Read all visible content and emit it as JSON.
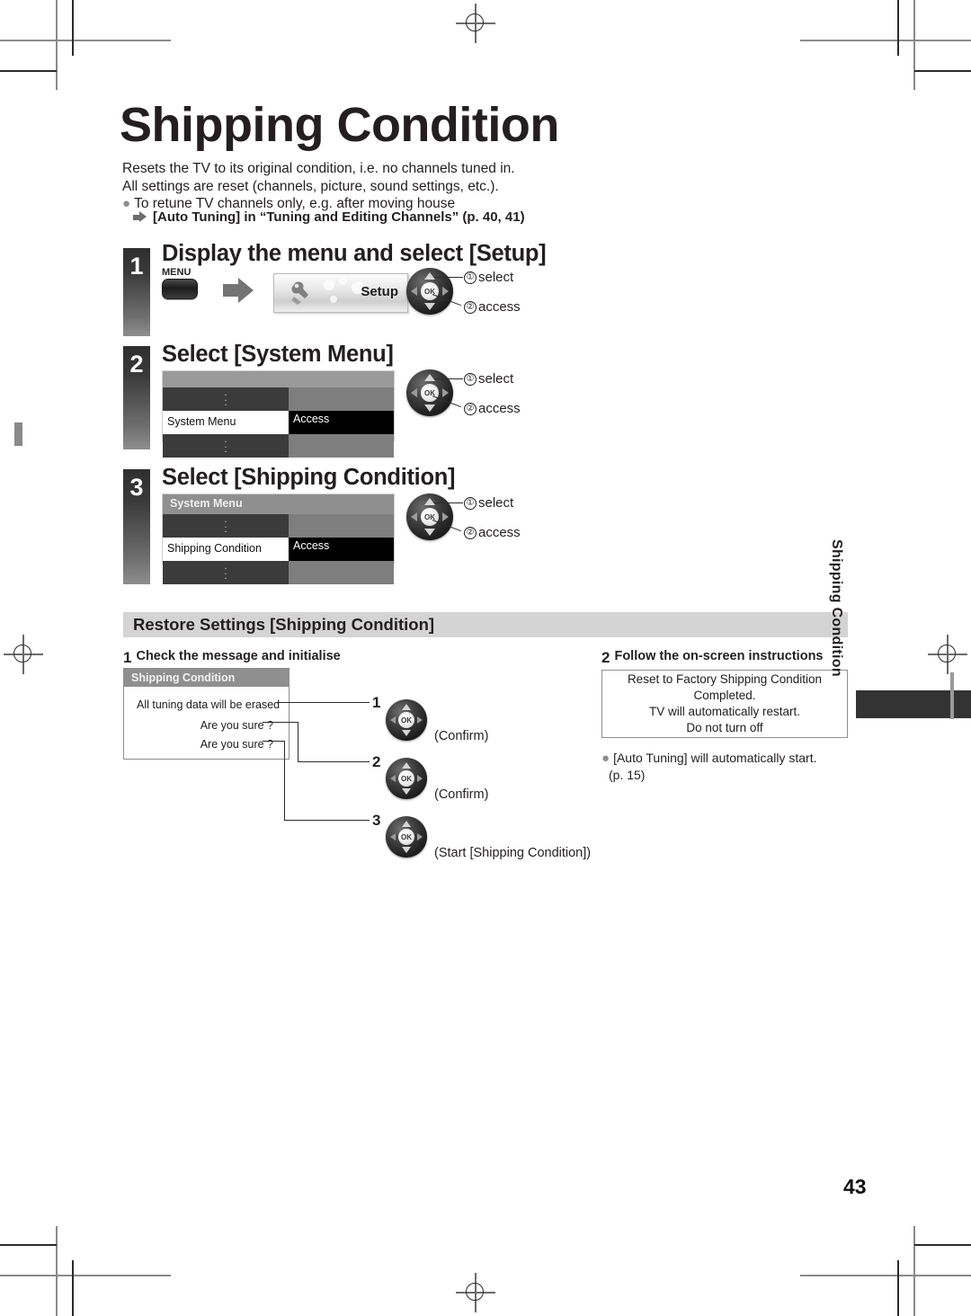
{
  "page": {
    "title": "Shipping Condition",
    "number": "43",
    "side_tab": "Shipping Condition",
    "intro": [
      "Resets the TV to its original condition, i.e. no channels tuned in.",
      "All settings are reset (channels, picture, sound settings, etc.)."
    ],
    "bullet": "To retune TV channels only, e.g. after moving house",
    "reference": "[Auto Tuning] in “Tuning and Editing Channels” (p. 40, 41)"
  },
  "steps": [
    {
      "number": "1",
      "title": "Display the menu and select [Setup]",
      "button_label": "MENU",
      "panel_label": "Setup",
      "annotations": [
        {
          "num": "①",
          "text": "select"
        },
        {
          "num": "②",
          "text": "access"
        }
      ]
    },
    {
      "number": "2",
      "title": "Select [System Menu]",
      "menu": {
        "header": "",
        "selected_item": "System Menu",
        "action": "Access"
      },
      "annotations": [
        {
          "num": "①",
          "text": "select"
        },
        {
          "num": "②",
          "text": "access"
        }
      ]
    },
    {
      "number": "3",
      "title": "Select [Shipping Condition]",
      "menu": {
        "header": "System Menu",
        "selected_item": "Shipping Condition",
        "action": "Access"
      },
      "annotations": [
        {
          "num": "①",
          "text": "select"
        },
        {
          "num": "②",
          "text": "access"
        }
      ]
    }
  ],
  "restore": {
    "section_title": "Restore Settings [Shipping Condition]",
    "left": {
      "step_num": "1",
      "heading": "Check the message and initialise",
      "dialog": {
        "title": "Shipping Condition",
        "lines": [
          "All tuning data will be erased",
          "Are you sure ?",
          "Are you sure ?"
        ]
      },
      "actions": [
        {
          "num": "1",
          "caption": "(Confirm)"
        },
        {
          "num": "2",
          "caption": "(Confirm)"
        },
        {
          "num": "3",
          "caption": "(Start [Shipping Condition])"
        }
      ]
    },
    "right": {
      "step_num": "2",
      "heading": "Follow the on-screen instructions",
      "message": [
        "Reset to Factory Shipping Condition",
        "Completed.",
        "TV will automatically restart.",
        "Do not turn off"
      ],
      "note": [
        "[Auto Tuning] will automatically start.",
        "(p. 15)"
      ]
    }
  },
  "ok_label": "OK"
}
